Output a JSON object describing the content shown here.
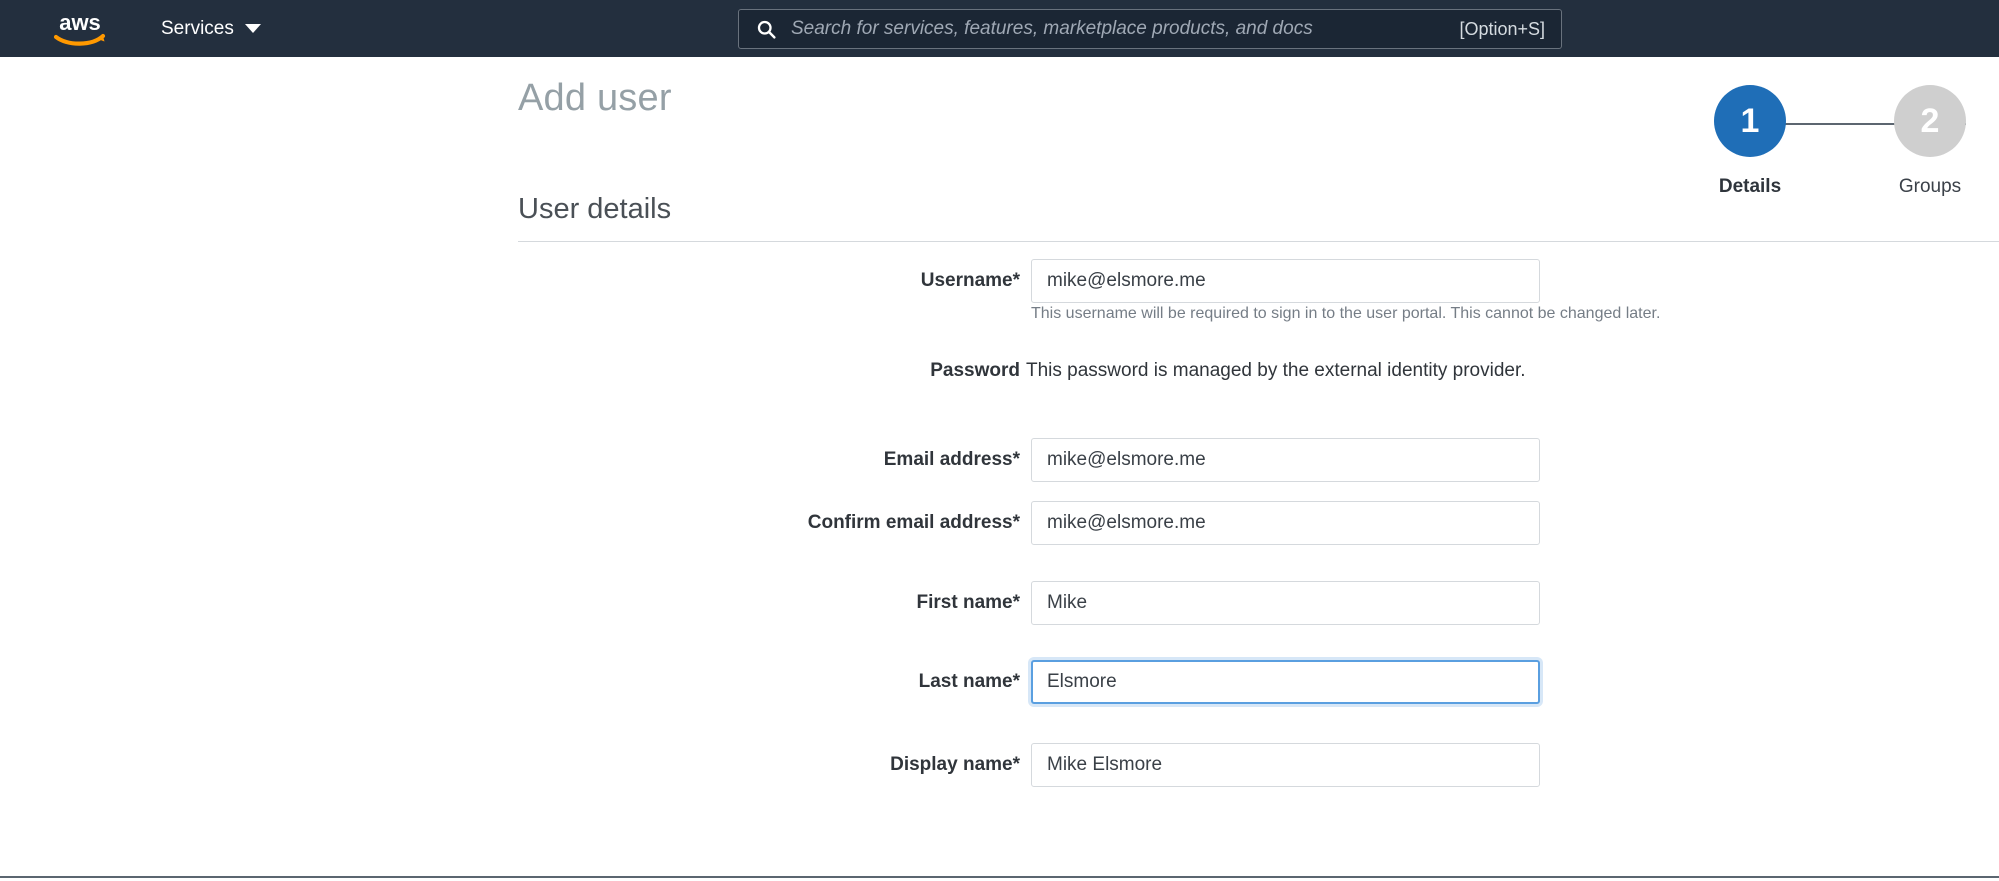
{
  "nav": {
    "logo_alt": "aws",
    "services_label": "Services",
    "search": {
      "placeholder": "Search for services, features, marketplace products, and docs",
      "shortcut": "[Option+S]"
    }
  },
  "page": {
    "title": "Add user",
    "section_title": "User details"
  },
  "steps": [
    {
      "number": "1",
      "label": "Details",
      "state": "active",
      "color": "#1f6eb7"
    },
    {
      "number": "2",
      "label": "Groups",
      "state": "inactive",
      "color": "#cfcfcf"
    }
  ],
  "form": {
    "fields": [
      {
        "label": "Username*",
        "value": "mike@elsmore.me",
        "placeholder": "",
        "type": "input",
        "focused": false,
        "hint": "This username will be required to sign in to the user portal. This cannot be changed later."
      },
      {
        "label": "Password",
        "value": "This password is managed by the external identity provider.",
        "placeholder": "",
        "type": "static",
        "focused": false,
        "hint": ""
      },
      {
        "label": "Email address*",
        "value": "mike@elsmore.me",
        "placeholder": "",
        "type": "input",
        "focused": false,
        "hint": ""
      },
      {
        "label": "Confirm email address*",
        "value": "mike@elsmore.me",
        "placeholder": "",
        "type": "input",
        "focused": false,
        "hint": ""
      },
      {
        "label": "First name*",
        "value": "Mike",
        "placeholder": "",
        "type": "input",
        "focused": false,
        "hint": ""
      },
      {
        "label": "Last name*",
        "value": "Elsmore",
        "placeholder": "",
        "type": "input",
        "focused": true,
        "hint": ""
      },
      {
        "label": "Display name*",
        "value": "Mike Elsmore",
        "placeholder": "",
        "type": "input",
        "focused": false,
        "hint": ""
      }
    ]
  },
  "colors": {
    "nav_background": "#232f3e",
    "accent_blue": "#1f6eb7",
    "focus_blue": "#5a9fe0",
    "logo_orange": "#ff9900"
  }
}
